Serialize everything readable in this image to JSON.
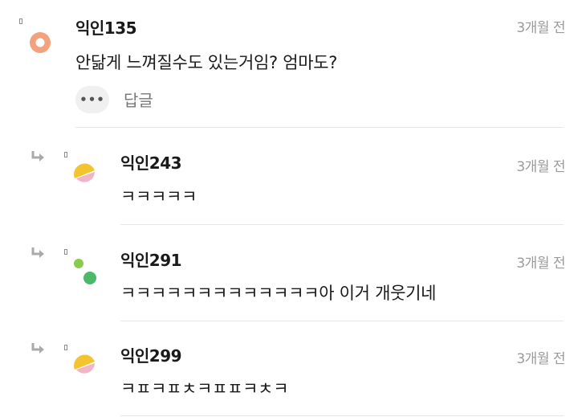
{
  "comments": [
    {
      "name": "익인135",
      "time": "3개월 전",
      "text": "안닮게 느껴질수도 있는거임? 엄마도?",
      "avatar_icon": "orange-ring-avatar",
      "more_icon": "•••",
      "reply_label": "답글"
    }
  ],
  "replies": [
    {
      "name": "익인243",
      "time": "3개월 전",
      "text": "ㅋㅋㅋㅋㅋ",
      "avatar_icon": "yellow-pink-circle-avatar"
    },
    {
      "name": "익인291",
      "time": "3개월 전",
      "text": "ㅋㅋㅋㅋㅋㅋㅋㅋㅋㅋㅋㅋㅋ아 이거 개웃기네",
      "avatar_icon": "green-dots-avatar"
    },
    {
      "name": "익인299",
      "time": "3개월 전",
      "text": "ㅋㅍㅋㅍㅊㅋㅍㅍㅋㅊㅋ",
      "avatar_icon": "yellow-pink-circle-avatar"
    }
  ],
  "colors": {
    "orange": "#F2A27C",
    "yellow": "#F4C430",
    "pink": "#F3B5C5",
    "green_light": "#8ACB4F",
    "green": "#4CB86A",
    "arrow": "#aaaaaa"
  }
}
